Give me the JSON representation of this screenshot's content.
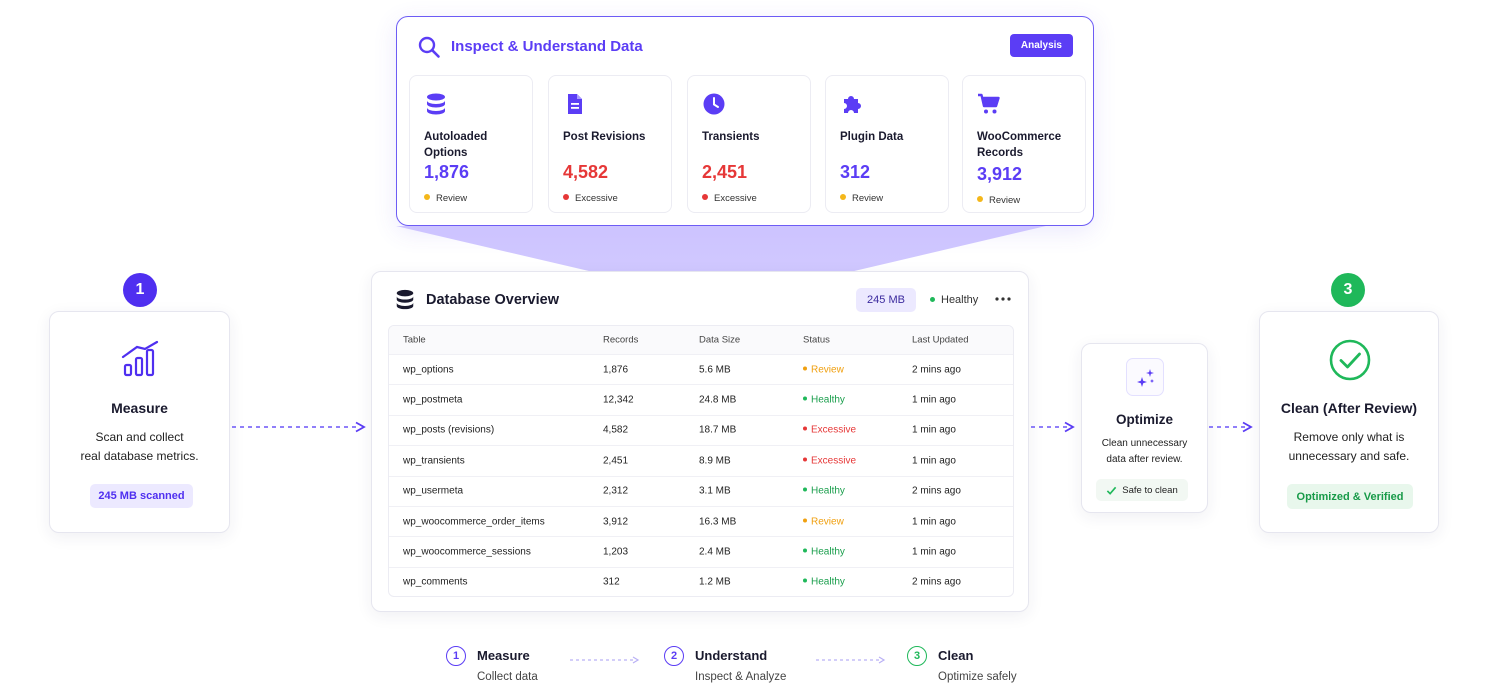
{
  "inspect": {
    "title": "Inspect & Understand Data",
    "badge": "Analysis",
    "icon": "search-icon",
    "metrics": [
      {
        "label": "Autoloaded Options",
        "value": "1,876",
        "status": "Review",
        "status_color": "#f4b71a",
        "value_color": "#5b3df5",
        "icon": "database-icon"
      },
      {
        "label": "Post Revisions",
        "value": "4,582",
        "status": "Excessive",
        "status_color": "#e63737",
        "value_color": "#e63737",
        "icon": "document-icon"
      },
      {
        "label": "Transients",
        "value": "2,451",
        "status": "Excessive",
        "status_color": "#e63737",
        "value_color": "#e63737",
        "icon": "clock-icon"
      },
      {
        "label": "Plugin Data",
        "value": "312",
        "status": "Review",
        "status_color": "#f4b71a",
        "value_color": "#5b3df5",
        "icon": "puzzle-icon"
      },
      {
        "label": "WooCommerce Records",
        "value": "3,912",
        "status": "Review",
        "status_color": "#f4b71a",
        "value_color": "#5b3df5",
        "icon": "cart-icon"
      }
    ]
  },
  "measure": {
    "step": "1",
    "title": "Measure",
    "desc_line1": "Scan and collect",
    "desc_line2": "real database metrics.",
    "pill": "245 MB scanned",
    "icon": "bar-chart-icon"
  },
  "database": {
    "title": "Database Overview",
    "size": "245 MB",
    "health": "Healthy",
    "columns": [
      "Table",
      "Records",
      "Data Size",
      "Status",
      "Last Updated"
    ],
    "rows": [
      {
        "table": "wp_options",
        "records": "1,876",
        "size": "5.6 MB",
        "status": "Review",
        "updated": "2 mins ago"
      },
      {
        "table": "wp_postmeta",
        "records": "12,342",
        "size": "24.8 MB",
        "status": "Healthy",
        "updated": "1 min ago"
      },
      {
        "table": "wp_posts (revisions)",
        "records": "4,582",
        "size": "18.7 MB",
        "status": "Excessive",
        "updated": "1 min ago"
      },
      {
        "table": "wp_transients",
        "records": "2,451",
        "size": "8.9 MB",
        "status": "Excessive",
        "updated": "1 min ago"
      },
      {
        "table": "wp_usermeta",
        "records": "2,312",
        "size": "3.1 MB",
        "status": "Healthy",
        "updated": "2 mins ago"
      },
      {
        "table": "wp_woocommerce_order_items",
        "records": "3,912",
        "size": "16.3 MB",
        "status": "Review",
        "updated": "1 min ago"
      },
      {
        "table": "wp_woocommerce_sessions",
        "records": "1,203",
        "size": "2.4 MB",
        "status": "Healthy",
        "updated": "1 min ago"
      },
      {
        "table": "wp_comments",
        "records": "312",
        "size": "1.2 MB",
        "status": "Healthy",
        "updated": "2 mins ago"
      }
    ]
  },
  "optimize": {
    "title": "Optimize",
    "desc_line1": "Clean unnecessary",
    "desc_line2": "data after review.",
    "safe": "Safe to clean",
    "icon": "sparkle-icon"
  },
  "clean": {
    "step": "3",
    "title": "Clean (After Review)",
    "desc_line1": "Remove only what is",
    "desc_line2": "unnecessary and safe.",
    "pill": "Optimized & Verified",
    "icon": "check-circle-icon"
  },
  "bottom_steps": [
    {
      "num": "1",
      "title": "Measure",
      "sub": "Collect data"
    },
    {
      "num": "2",
      "title": "Understand",
      "sub": "Inspect & Analyze"
    },
    {
      "num": "3",
      "title": "Clean",
      "sub": "Optimize safely"
    }
  ],
  "colors": {
    "accent": "#5b3df5",
    "success": "#1fb85a",
    "danger": "#e63737",
    "warning": "#f4b71a"
  }
}
